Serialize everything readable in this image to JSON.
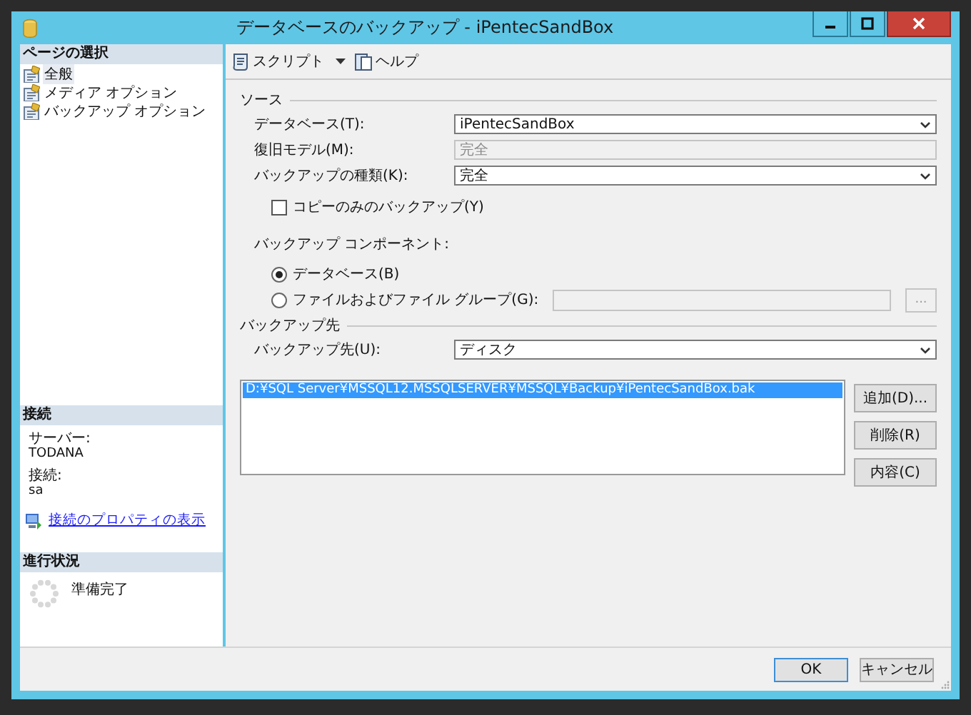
{
  "window": {
    "title": "データベースのバックアップ - iPentecSandBox"
  },
  "sidebar": {
    "pages_header": "ページの選択",
    "items": [
      {
        "label": "全般",
        "selected": true
      },
      {
        "label": "メディア オプション",
        "selected": false
      },
      {
        "label": "バックアップ オプション",
        "selected": false
      }
    ],
    "connection_header": "接続",
    "connection_fields": [
      {
        "label": "サーバー:",
        "value": "TODANA"
      },
      {
        "label": "接続:",
        "value": "sa"
      }
    ],
    "connection_link": "接続のプロパティの表示",
    "progress_header": "進行状況",
    "progress_status": "準備完了"
  },
  "toolbar": [
    {
      "label": "スクリプト",
      "kind": "dropdown"
    },
    {
      "label": "ヘルプ",
      "kind": "button"
    }
  ],
  "source": {
    "title": "ソース",
    "rows": [
      {
        "label": "データベース(T):",
        "value": "iPentecSandBox",
        "kind": "combo"
      },
      {
        "label": "復旧モデル(M):",
        "value": "完全",
        "kind": "readonly"
      },
      {
        "label": "バックアップの種類(K):",
        "value": "完全",
        "kind": "combo"
      }
    ],
    "copy_only": {
      "label": "コピーのみのバックアップ(Y)",
      "checked": false
    },
    "component_label": "バックアップ コンポーネント:",
    "components": [
      {
        "label": "データベース(B)",
        "selected": true
      },
      {
        "label": "ファイルおよびファイル グループ(G):",
        "selected": false
      }
    ],
    "browse_button": {
      "label": "...",
      "disabled": true
    }
  },
  "destination": {
    "title": "バックアップ先",
    "label": "バックアップ先(U):",
    "value": "ディスク",
    "files": [
      {
        "path": "D:¥SQL Server¥MSSQL12.MSSQLSERVER¥MSSQL¥Backup¥iPentecSandBox.bak",
        "selected": true
      }
    ],
    "buttons": [
      "追加(D)...",
      "削除(R)",
      "内容(C)"
    ]
  },
  "footer": [
    {
      "label": "OK",
      "default": true
    },
    {
      "label": "キャンセル",
      "default": false
    }
  ]
}
